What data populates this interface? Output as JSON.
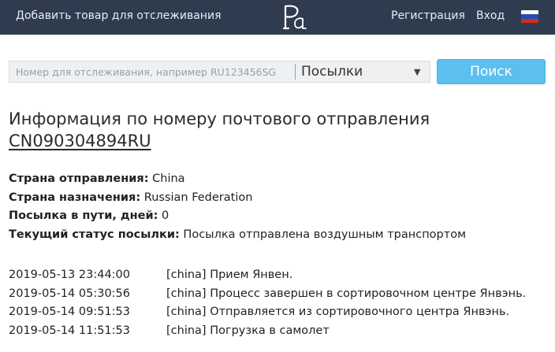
{
  "header": {
    "add_item_label": "Добавить товар для отслеживания",
    "register_label": "Регистрация",
    "login_label": "Вход",
    "logo_icon": "site-logo-icon",
    "flag_icon": "russian-flag-icon",
    "bg_color": "#2f3b4f"
  },
  "search": {
    "placeholder": "Номер для отслеживания, например RU123456SG",
    "value": "",
    "type_selected": "Посылки",
    "button_label": "Поиск",
    "button_color": "#5bc0f0"
  },
  "main": {
    "title_prefix": "Информация по номеру почтового отправления",
    "tracking_number": "CN090304894RU"
  },
  "details": [
    {
      "label": "Страна отправления:",
      "value": "China"
    },
    {
      "label": "Страна назначения:",
      "value": "Russian Federation"
    },
    {
      "label": "Посылка в пути, дней:",
      "value": "0"
    },
    {
      "label": "Текущий статус посылки:",
      "value": "Посылка отправлена воздушным транспортом"
    }
  ],
  "events": [
    {
      "datetime": "2019-05-13 23:44:00",
      "description": "[china] Прием Янвен."
    },
    {
      "datetime": "2019-05-14 05:30:56",
      "description": "[china] Процесс завершен в сортировочном центре Янвэнь."
    },
    {
      "datetime": "2019-05-14 09:51:53",
      "description": "[china] Отправляется из сортировочного центра Янвэнь."
    },
    {
      "datetime": "2019-05-14 11:51:53",
      "description": "[china] Погрузка в самолет"
    }
  ]
}
